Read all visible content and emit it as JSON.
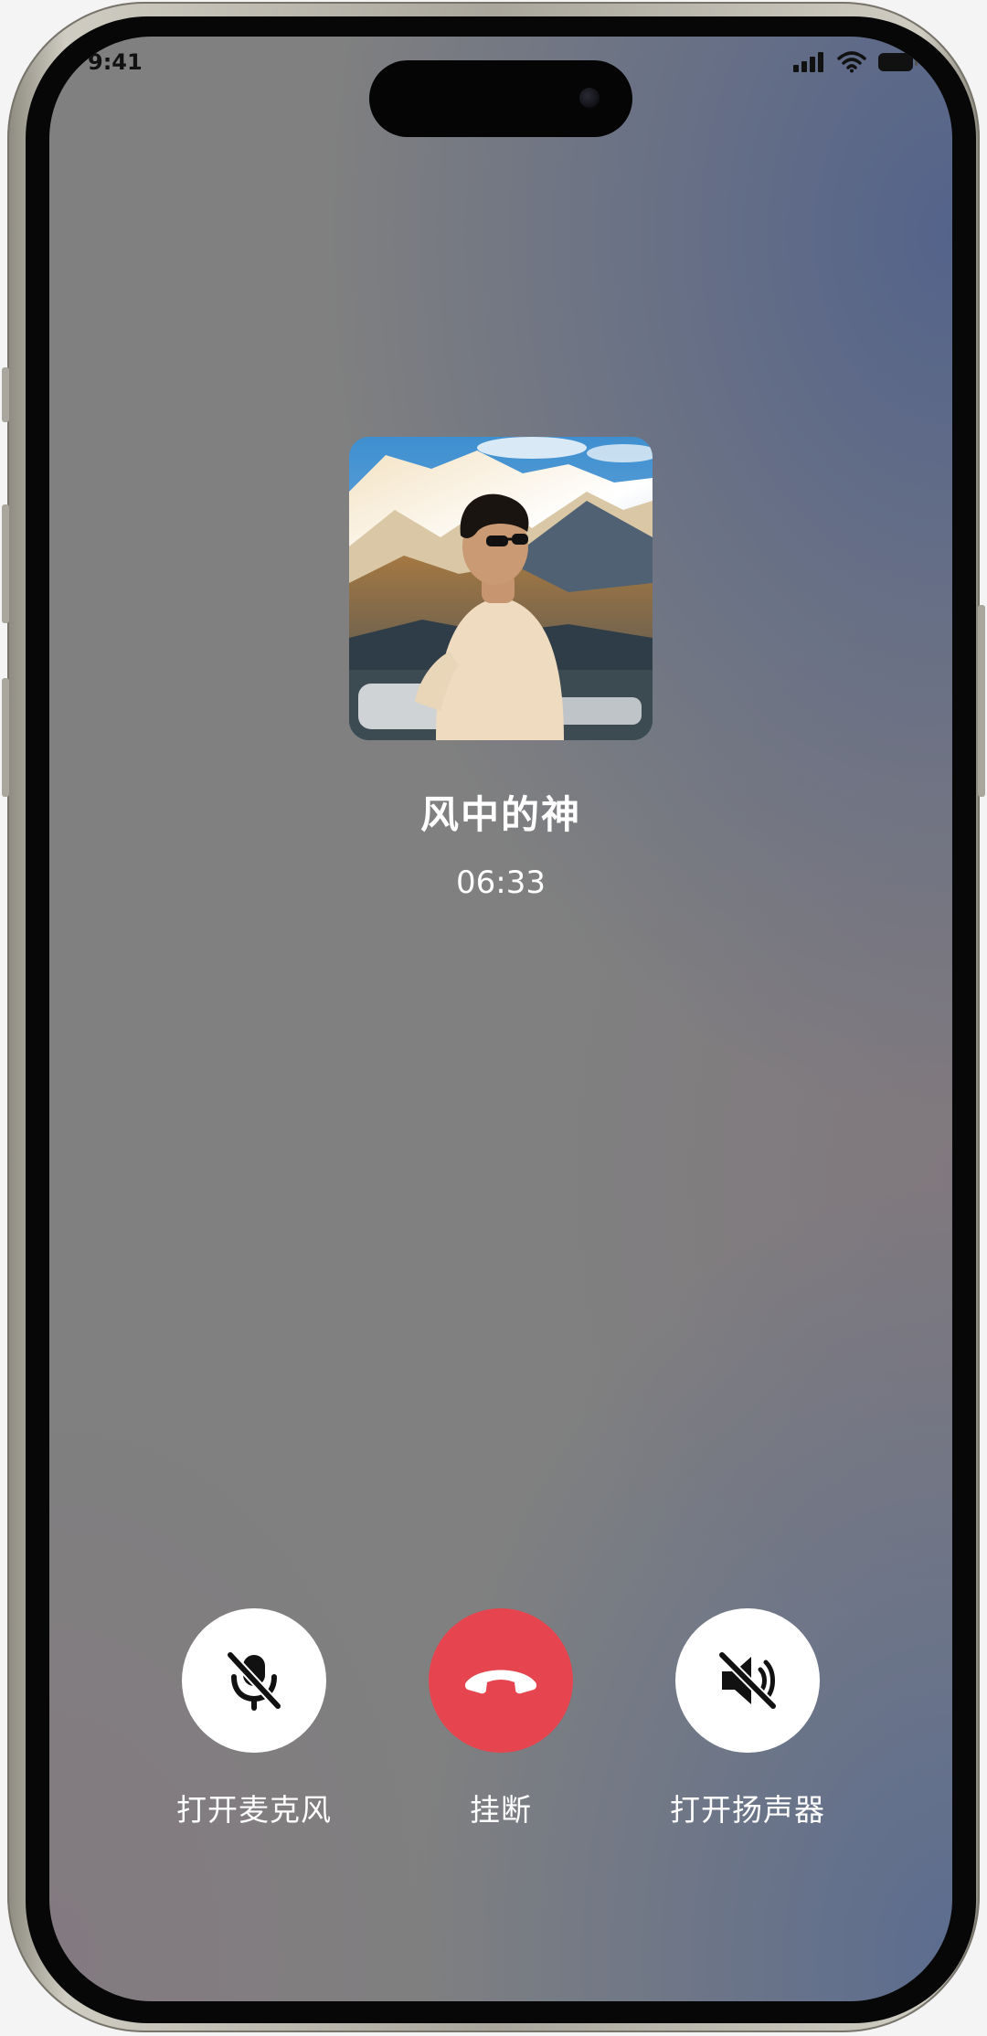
{
  "status_bar": {
    "time": "9:41"
  },
  "caller": {
    "name": "风中的神",
    "duration": "06:33"
  },
  "controls": {
    "mic_label": "打开麦克风",
    "hangup_label": "挂断",
    "speaker_label": "打开扬声器"
  },
  "colors": {
    "hangup": "#e6454f",
    "control_bg": "#ffffff",
    "screen_bg": "#808080",
    "accent_blue": "#4c5e8c"
  },
  "icons": {
    "mic": "microphone-off-icon",
    "hangup": "phone-hangup-icon",
    "speaker": "speaker-off-icon"
  }
}
